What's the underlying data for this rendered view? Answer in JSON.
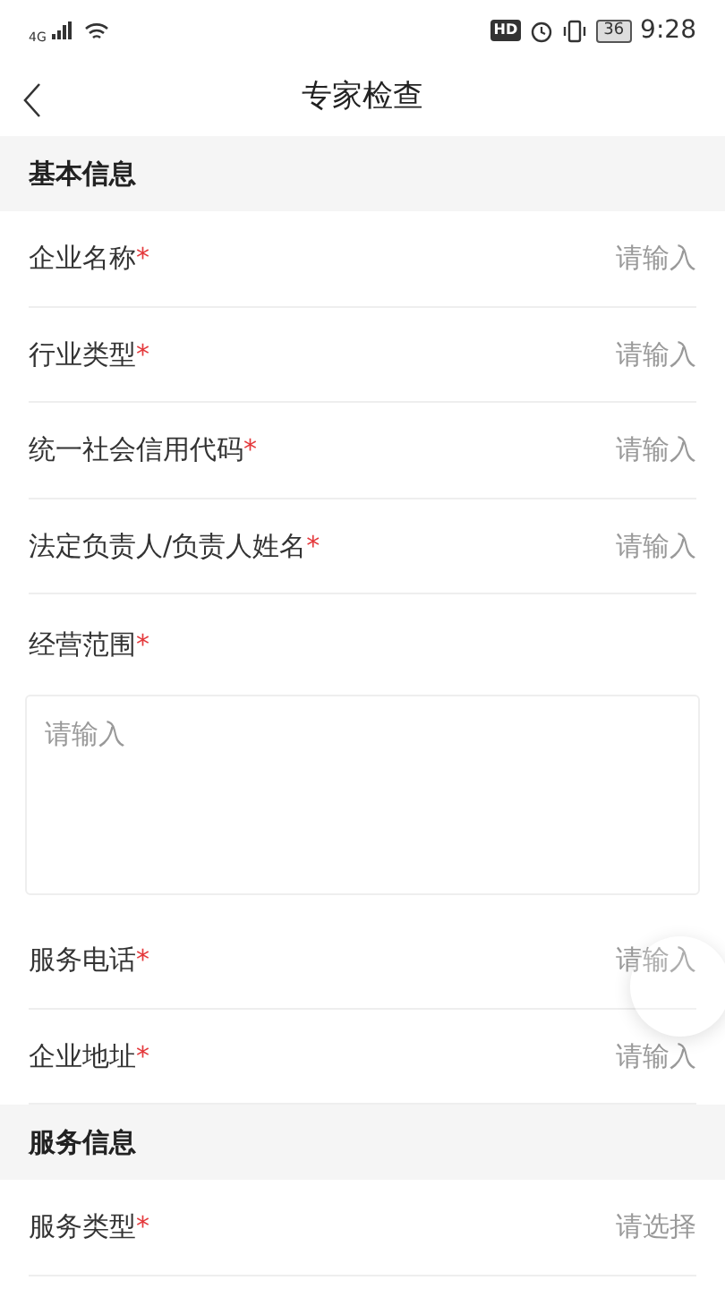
{
  "status_bar": {
    "network": "4G",
    "hd": "HD",
    "battery": "36",
    "time": "9:28"
  },
  "header": {
    "title": "专家检查"
  },
  "sections": [
    {
      "title": "基本信息",
      "fields": [
        {
          "kind": "input",
          "label": "企业名称",
          "required_mark": "*",
          "placeholder": "请输入"
        },
        {
          "kind": "input",
          "label": "行业类型",
          "required_mark": "*",
          "placeholder": "请输入"
        },
        {
          "kind": "input",
          "label": "统一社会信用代码",
          "required_mark": "*",
          "placeholder": "请输入"
        },
        {
          "kind": "input",
          "label": "法定负责人/负责人姓名",
          "required_mark": "*",
          "placeholder": "请输入"
        },
        {
          "kind": "textarea",
          "label": "经营范围",
          "required_mark": "*",
          "placeholder": "请输入"
        },
        {
          "kind": "input",
          "label": "服务电话",
          "required_mark": "*",
          "placeholder": "请输入"
        },
        {
          "kind": "input",
          "label": "企业地址",
          "required_mark": "*",
          "placeholder": "请输入"
        }
      ]
    },
    {
      "title": "服务信息",
      "fields": [
        {
          "kind": "select",
          "label": "服务类型",
          "required_mark": "*",
          "placeholder": "请选择"
        }
      ]
    }
  ]
}
